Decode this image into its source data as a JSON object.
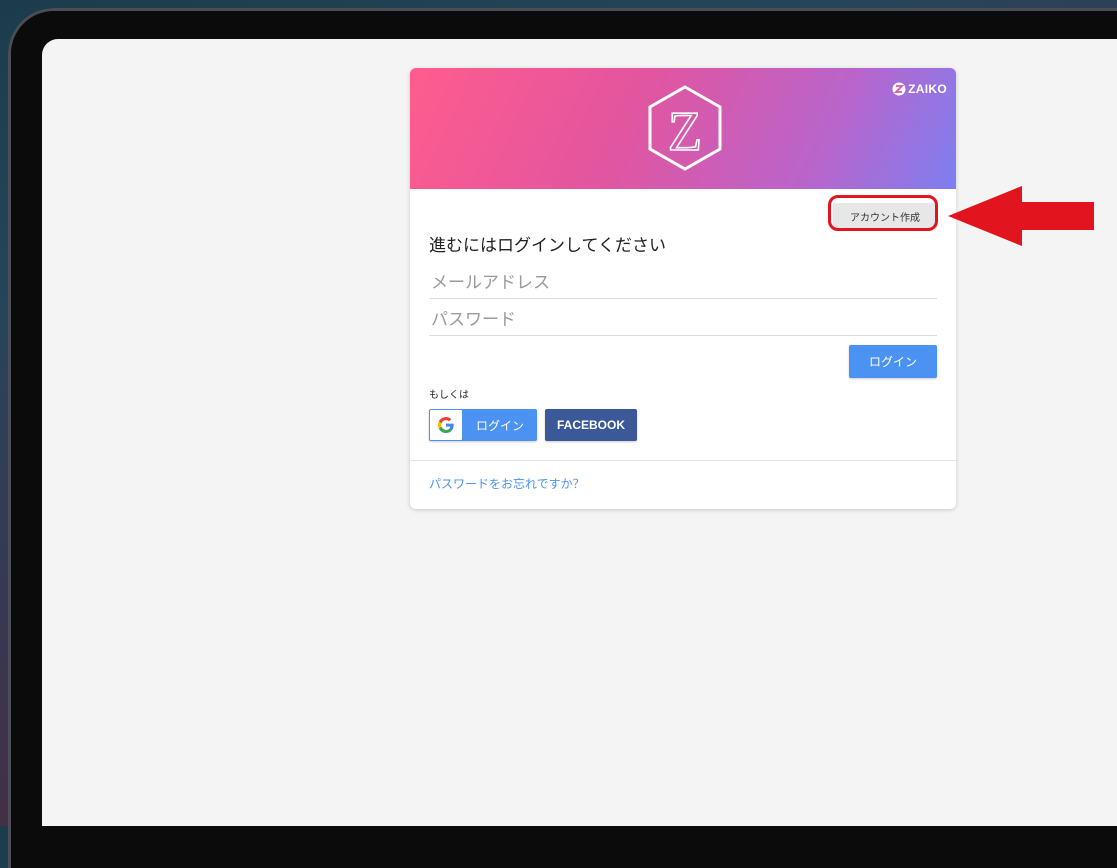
{
  "brand": {
    "name": "ZAIKO",
    "logo_letter": "Z"
  },
  "header": {
    "create_account_label": "アカウント作成"
  },
  "login": {
    "heading": "進むにはログインしてください",
    "email_placeholder": "メールアドレス",
    "password_placeholder": "パスワード",
    "login_button": "ログイン",
    "or_label": "もしくは",
    "google_button": "ログイン",
    "facebook_button": "FACEBOOK",
    "forgot_password": "パスワードをお忘れですか？"
  },
  "colors": {
    "primary": "#4b92f3",
    "facebook": "#3b5998",
    "header_gradient_start": "#ff5c8d",
    "header_gradient_end": "#7e7ff0",
    "annotation": "#e2141e"
  },
  "icons": [
    "zaiko-logo-icon",
    "zaiko-brand-icon",
    "google-icon",
    "red-arrow-annotation"
  ]
}
